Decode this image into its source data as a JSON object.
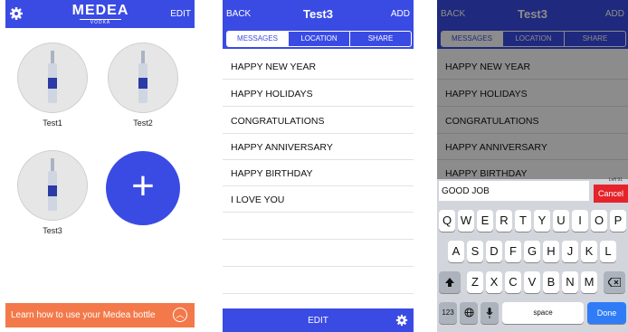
{
  "screen1": {
    "brand": "MEDEA",
    "brand_sub": "VODKA",
    "edit_label": "EDIT",
    "bottles": [
      {
        "name": "Test1"
      },
      {
        "name": "Test2"
      },
      {
        "name": "Test3"
      }
    ],
    "add_symbol": "+",
    "banner_text": "Learn how to use your Medea bottle",
    "banner_icon": "chevron-up-circle-icon"
  },
  "screen2": {
    "back_label": "BACK",
    "title": "Test3",
    "add_label": "ADD",
    "tabs": [
      {
        "label": "MESSAGES",
        "active": true
      },
      {
        "label": "LOCATION",
        "active": false
      },
      {
        "label": "SHARE",
        "active": false
      }
    ],
    "messages": [
      "HAPPY NEW YEAR",
      "HAPPY HOLIDAYS",
      "CONGRATULATIONS",
      "HAPPY ANNIVERSARY",
      "HAPPY BIRTHDAY",
      "I LOVE YOU"
    ],
    "edit_label": "EDIT"
  },
  "screen3": {
    "back_label": "BACK",
    "title": "Test3",
    "add_label": "ADD",
    "tabs": [
      "MESSAGES",
      "LOCATION",
      "SHARE"
    ],
    "messages": [
      "HAPPY NEW YEAR",
      "HAPPY HOLIDAYS",
      "CONGRATULATIONS",
      "HAPPY ANNIVERSARY",
      "HAPPY BIRTHDAY"
    ],
    "input_value": "GOOD JOB",
    "left_count": "Left 91",
    "cancel_label": "Cancel",
    "keyboard": {
      "row1": [
        "Q",
        "W",
        "E",
        "R",
        "T",
        "Y",
        "U",
        "I",
        "O",
        "P"
      ],
      "row2": [
        "A",
        "S",
        "D",
        "F",
        "G",
        "H",
        "J",
        "K",
        "L"
      ],
      "row3": [
        "Z",
        "X",
        "C",
        "V",
        "B",
        "N",
        "M"
      ],
      "numbers_key": "123",
      "space_key": "space",
      "done_key": "Done"
    }
  },
  "colors": {
    "accent": "#3a4be4",
    "banner": "#f3794a",
    "cancel": "#e6232a",
    "done": "#2f7cf6"
  }
}
